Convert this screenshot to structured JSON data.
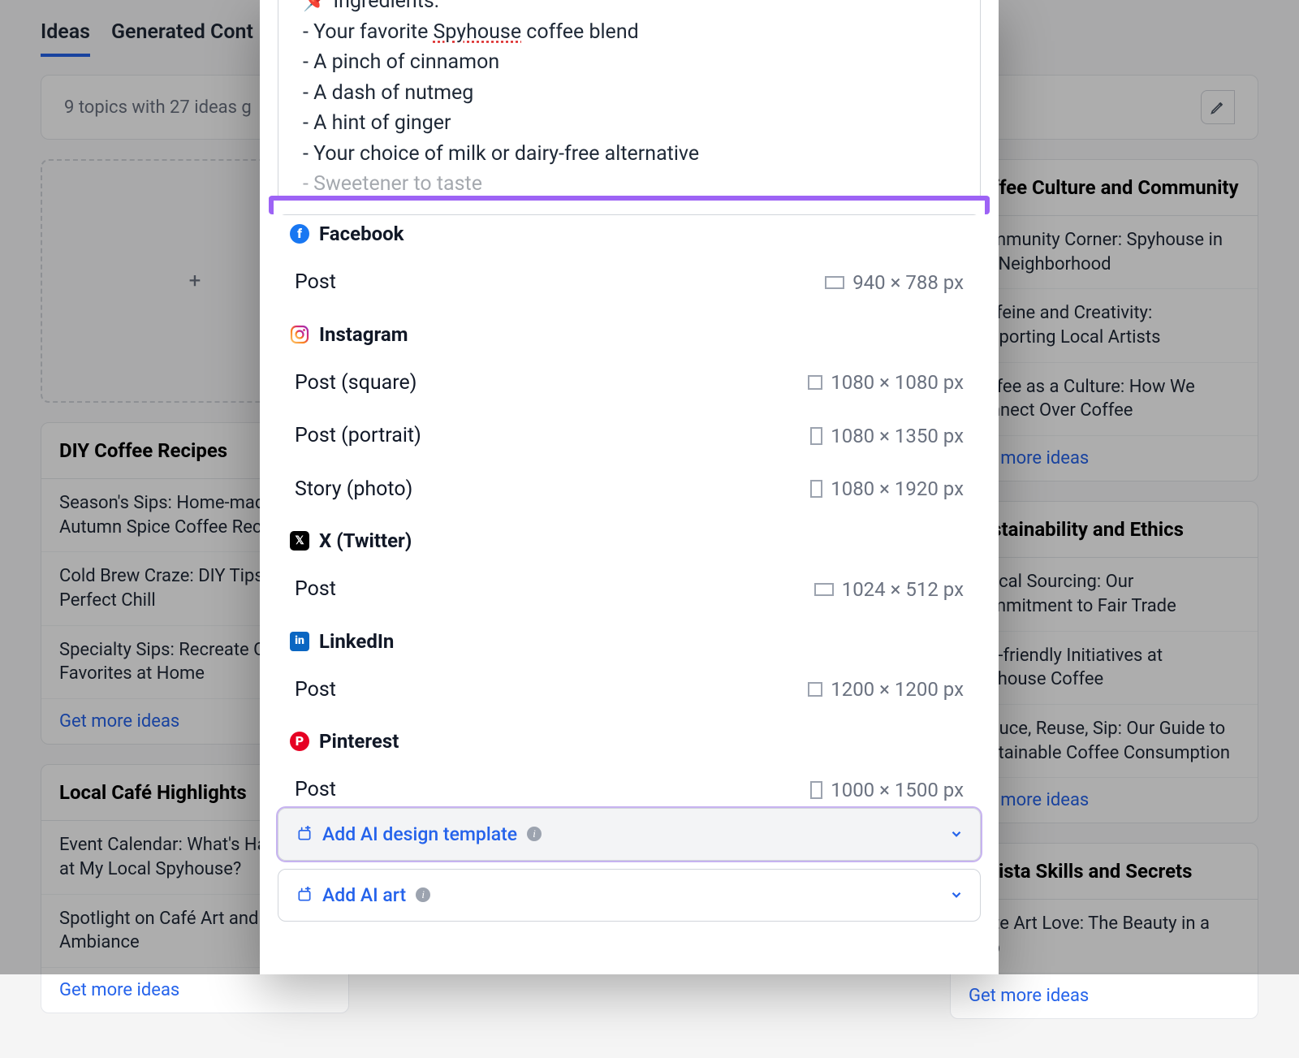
{
  "tabs": {
    "ideas": "Ideas",
    "generated": "Generated Cont"
  },
  "summary": "9 topics with 27 ideas g",
  "recipe": {
    "ingredients_label": "Ingredients:",
    "items": [
      "Your favorite ",
      "Spyhouse",
      " coffee blend",
      "A pinch of cinnamon",
      "A dash of nutmeg",
      "A hint of ginger",
      "Your choice of milk or dairy-free alternative",
      "Sweetener to taste"
    ]
  },
  "platforms": [
    {
      "name": "Facebook",
      "icon": "fb",
      "options": [
        {
          "label": "Post",
          "dim": "940 × 788 px",
          "shape": "land"
        }
      ]
    },
    {
      "name": "Instagram",
      "icon": "ig",
      "options": [
        {
          "label": "Post (square)",
          "dim": "1080 × 1080 px",
          "shape": "sq"
        },
        {
          "label": "Post (portrait)",
          "dim": "1080 × 1350 px",
          "shape": "port"
        },
        {
          "label": "Story (photo)",
          "dim": "1080 × 1920 px",
          "shape": "port"
        }
      ]
    },
    {
      "name": "X (Twitter)",
      "icon": "x",
      "options": [
        {
          "label": "Post",
          "dim": "1024 × 512 px",
          "shape": "land"
        }
      ]
    },
    {
      "name": "LinkedIn",
      "icon": "li",
      "options": [
        {
          "label": "Post",
          "dim": "1200 × 1200 px",
          "shape": "sq"
        }
      ]
    },
    {
      "name": "Pinterest",
      "icon": "pin",
      "options": [
        {
          "label": "Post",
          "dim": "1000 × 1500 px",
          "shape": "port"
        }
      ]
    }
  ],
  "actions": {
    "add_template": "Add AI design template",
    "add_art": "Add AI art"
  },
  "left_cards": [
    {
      "title": "DIY Coffee Recipes",
      "ideas": [
        "Season's Sips: Home-made Autumn Spice Coffee Recipe",
        "Cold Brew Craze: DIY Tips for the Perfect Chill",
        "Specialty Sips: Recreate Café Favorites at Home"
      ]
    },
    {
      "title": "Local Café Highlights",
      "ideas": [
        "Event Calendar: What's Happening at My Local Spyhouse?",
        "Spotlight on Café Art and Ambiance"
      ]
    }
  ],
  "right_cards": [
    {
      "title": "Coffee Culture and Community",
      "ideas": [
        "Community Corner: Spyhouse in the Neighborhood",
        "Caffeine and Creativity: Supporting Local Artists",
        "Coffee as a Culture: How We Connect Over Coffee"
      ]
    },
    {
      "title": "Sustainability and Ethics",
      "ideas": [
        "Ethical Sourcing: Our Commitment to Fair Trade",
        "Eco-friendly Initiatives at Spyhouse Coffee",
        "Reduce, Reuse, Sip: Our Guide to Sustainable Coffee Consumption"
      ]
    },
    {
      "title": "Barista Skills and Secrets",
      "ideas": [
        "Latte Art Love: The Beauty in a Cup"
      ]
    }
  ],
  "get_more": "Get more ideas"
}
